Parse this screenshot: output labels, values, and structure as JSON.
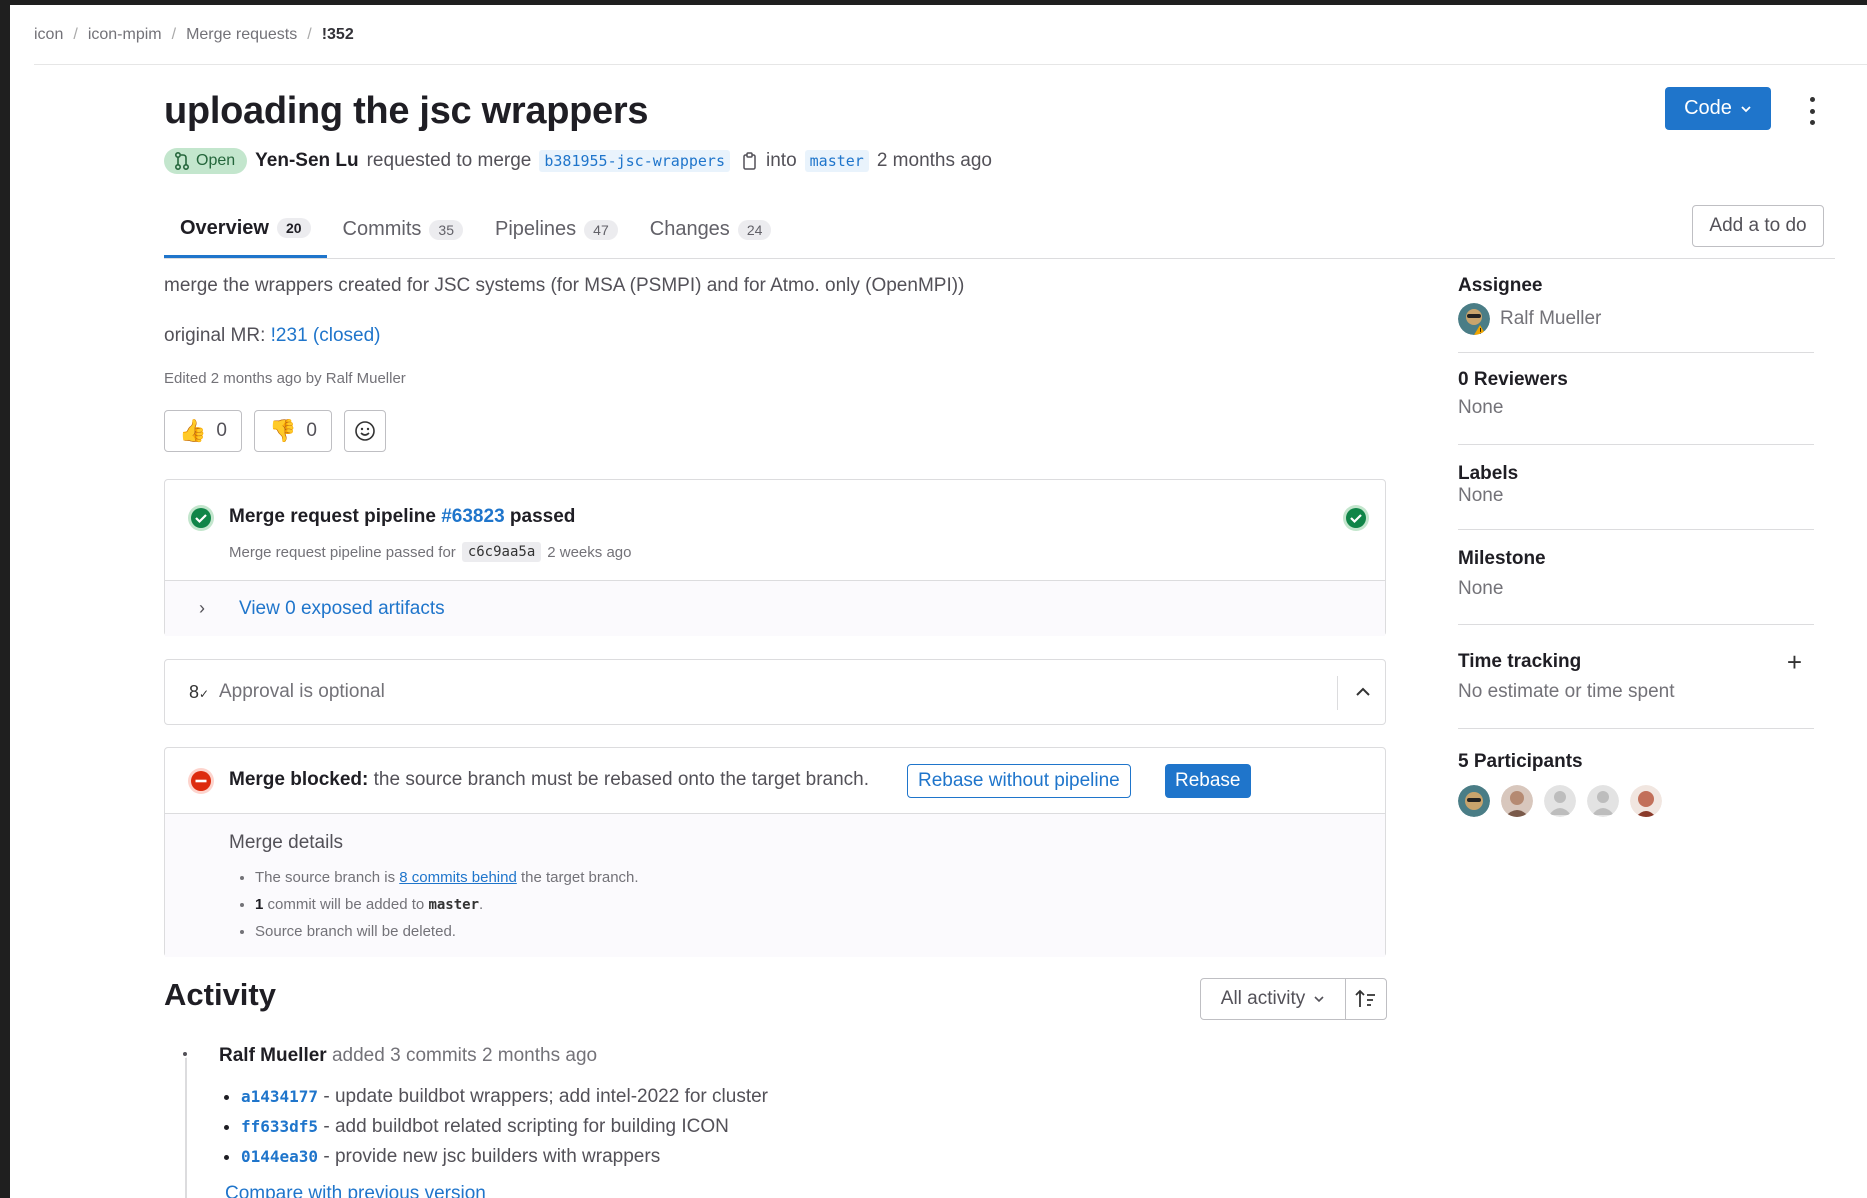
{
  "breadcrumb": {
    "items": [
      "icon",
      "icon-mpim",
      "Merge requests",
      "!352"
    ]
  },
  "header": {
    "title": "uploading the jsc wrappers",
    "code_button": "Code",
    "status": "Open",
    "author": "Yen-Sen Lu",
    "requested_text": "requested to merge",
    "source_branch": "b381955-jsc-wrappers",
    "into_text": "into",
    "target_branch": "master",
    "time_ago": "2 months ago"
  },
  "tabs": [
    {
      "label": "Overview",
      "count": "20",
      "active": true
    },
    {
      "label": "Commits",
      "count": "35"
    },
    {
      "label": "Pipelines",
      "count": "47"
    },
    {
      "label": "Changes",
      "count": "24"
    }
  ],
  "todo_button": "Add a to do",
  "description": {
    "text": "merge the wrappers created for JSC systems (for MSA (PSMPI) and for Atmo. only (OpenMPI))",
    "original_label": "original MR:",
    "original_link": "!231 (closed)",
    "edited": "Edited 2 months ago by Ralf Mueller"
  },
  "reactions": {
    "thumbs_up_count": "0",
    "thumbs_down_count": "0"
  },
  "pipeline": {
    "title_prefix": "Merge request pipeline",
    "pipeline_id": "#63823",
    "title_suffix": "passed",
    "sub_prefix": "Merge request pipeline passed for",
    "sha": "c6c9aa5a",
    "sub_suffix": "2 weeks ago",
    "artifacts_link": "View 0 exposed artifacts"
  },
  "approval": {
    "text": "Approval is optional"
  },
  "merge": {
    "blocked_label": "Merge blocked:",
    "blocked_text": "the source branch must be rebased onto the target branch.",
    "rebase_no_pipeline": "Rebase without pipeline",
    "rebase": "Rebase",
    "details_title": "Merge details",
    "d1_prefix": "The source branch is",
    "d1_link": "8 commits behind",
    "d1_suffix": "the target branch.",
    "d2_count": "1",
    "d2_text": "commit will be added to",
    "d2_branch": "master",
    "d2_end": ".",
    "d3": "Source branch will be deleted."
  },
  "activity": {
    "title": "Activity",
    "filter": "All activity",
    "event_author": "Ralf Mueller",
    "event_text": "added 3 commits 2 months ago",
    "commits": [
      {
        "sha": "a1434177",
        "msg": "- update buildbot wrappers; add intel-2022 for cluster"
      },
      {
        "sha": "ff633df5",
        "msg": "- add buildbot related scripting for building ICON"
      },
      {
        "sha": "0144ea30",
        "msg": "- provide new jsc builders with wrappers"
      }
    ],
    "compare_link": "Compare with previous version"
  },
  "sidebar": {
    "assignee_label": "Assignee",
    "assignee_name": "Ralf Mueller",
    "reviewers_label": "0 Reviewers",
    "reviewers_value": "None",
    "labels_label": "Labels",
    "labels_value": "None",
    "milestone_label": "Milestone",
    "milestone_value": "None",
    "time_label": "Time tracking",
    "time_value": "No estimate or time spent",
    "participants_label": "5 Participants"
  },
  "colors": {
    "brand_blue": "#1f75cb",
    "success_green": "#108548",
    "danger_red": "#dd2b0e"
  }
}
